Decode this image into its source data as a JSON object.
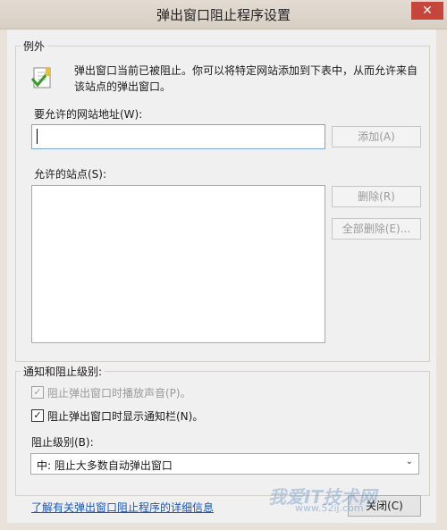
{
  "window": {
    "title": "弹出窗口阻止程序设置",
    "close_glyph": "✕"
  },
  "exceptions": {
    "group_label": "例外",
    "info_line1": "弹出窗口当前已被阻止。你可以将特定网站添加到下表中，从而允许来自",
    "info_line2": "该站点的弹出窗口。",
    "address_label": "要允许的网站地址(W):",
    "address_value": "",
    "add_button": "添加(A)",
    "sites_label": "允许的站点(S):",
    "remove_button": "删除(R)",
    "remove_all_button": "全部删除(E)..."
  },
  "notification": {
    "group_label": "通知和阻止级别:",
    "play_sound_label": "阻止弹出窗口时播放声音(P)。",
    "play_sound_checked": true,
    "show_bar_label": "阻止弹出窗口时显示通知栏(N)。",
    "show_bar_checked": true,
    "level_label": "阻止级别(B):",
    "level_value": "中: 阻止大多数自动弹出窗口"
  },
  "footer": {
    "learn_more_link": "了解有关弹出窗口阻止程序的详细信息",
    "close_button": "关闭(C)"
  },
  "watermark": {
    "text": "我爱IT技术网",
    "sub": "www.52ij.com"
  },
  "icons": {
    "info_icon": "checkmark-document-icon",
    "check_glyph": "✓",
    "dropdown_glyph": "⌄"
  }
}
